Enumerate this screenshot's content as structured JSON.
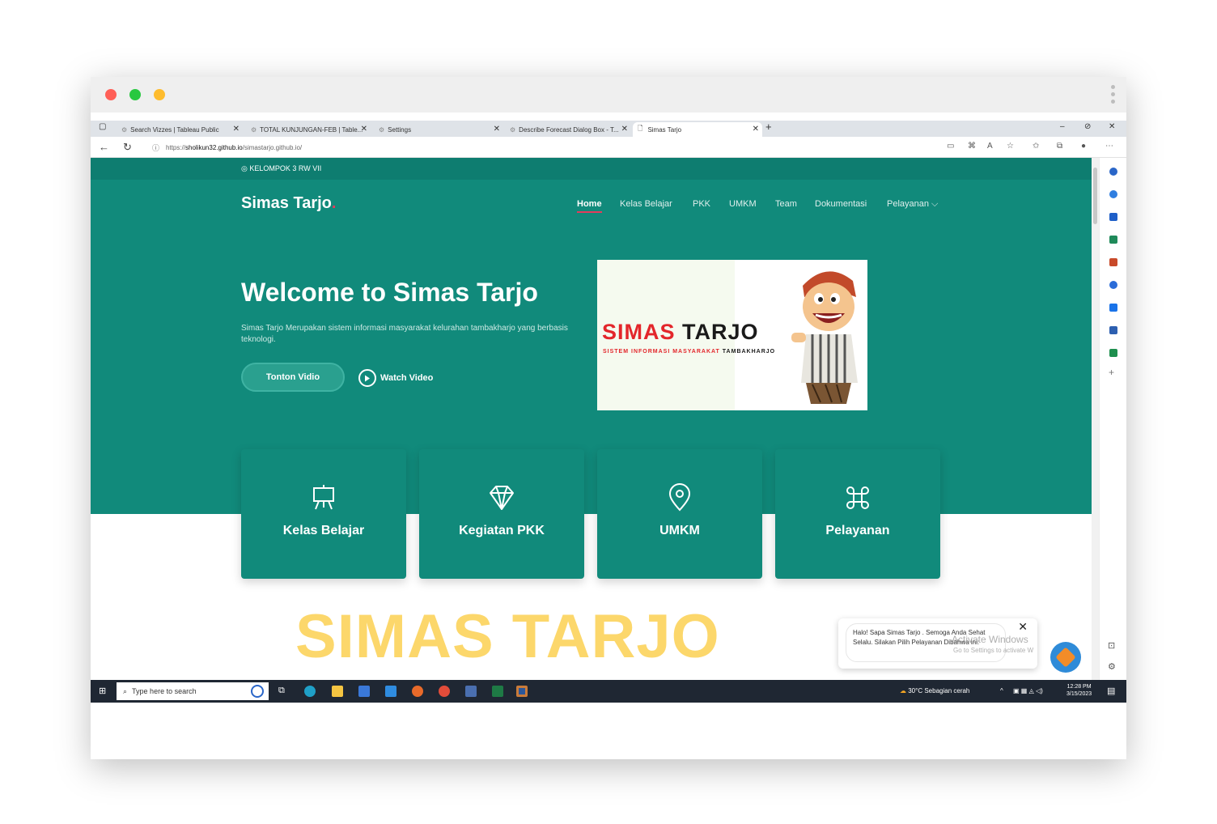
{
  "browser": {
    "tabs": [
      {
        "label": "Search Vizzes | Tableau Public"
      },
      {
        "label": "TOTAL KUNJUNGAN-FEB | Table..."
      },
      {
        "label": "Settings"
      },
      {
        "label": "Describe Forecast Dialog Box - T..."
      },
      {
        "label": "Simas Tarjo"
      }
    ],
    "url_prefix": "https://",
    "url_host": "sholikun32.github.io",
    "url_path": "/simastarjo.github.io/"
  },
  "site": {
    "topline": "KELOMPOK 3 RW VII",
    "brand": "Simas Tarjo",
    "brand_dot": ".",
    "menu": [
      "Home",
      "Kelas Belajar",
      "PKK",
      "UMKM",
      "Team",
      "Dokumentasi",
      "Pelayanan ⌵"
    ],
    "hero_title": "Welcome to Simas Tarjo",
    "hero_desc": "Simas Tarjo Merupakan sistem informasi masyarakat kelurahan tambakharjo yang berbasis teknologi.",
    "btn_primary": "Tonton Vidio",
    "btn_secondary": "Watch Video",
    "logo_red": "SIMAS ",
    "logo_black": "TARJO",
    "logo_sub_red": "SISTEM INFORMASI MASYARAKAT ",
    "logo_sub_black": "TAMBAKHARJO",
    "cards": [
      {
        "label": "Kelas Belajar",
        "icon": "easel-icon"
      },
      {
        "label": "Kegiatan PKK",
        "icon": "diamond-icon"
      },
      {
        "label": "UMKM",
        "icon": "map-pin-icon"
      },
      {
        "label": "Pelayanan",
        "icon": "command-icon"
      }
    ],
    "overlay_title": "SIMAS TARJO",
    "chat_text": "Halo! Sapa Simas Tarjo . Semoga Anda Sehat Selalu. Silakan Pilih Pelayanan Dibahwa ini:",
    "activate_title": "Activate Windows",
    "activate_sub": "Go to Settings to activate W"
  },
  "taskbar": {
    "search_placeholder": "Type here to search",
    "weather": "30°C  Sebagian cerah",
    "time": "12:28 PM",
    "date": "3/15/2023"
  },
  "colors": {
    "primary": "#118a7b",
    "accent": "#e43c5c",
    "overlay": "#fcd76b"
  }
}
